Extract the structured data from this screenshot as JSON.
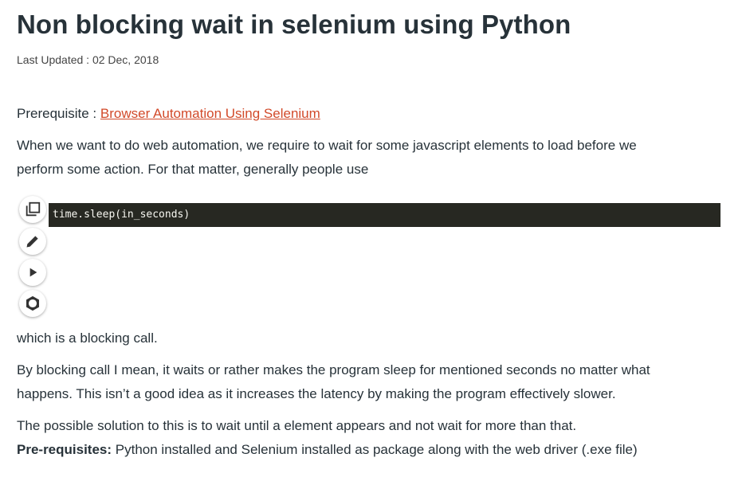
{
  "article": {
    "title": "Non blocking wait in selenium using Python",
    "last_updated": "Last Updated : 02 Dec, 2018",
    "prereq_prefix": "Prerequisite : ",
    "prereq_link": "Browser Automation Using Selenium",
    "para1_line1": "When we want to do web automation, we require to wait for some javascript elements to load before we",
    "para1_line2": "perform some action. For that matter, generally people use",
    "code": "time.sleep(in_seconds)",
    "para2": "which is a blocking call.",
    "para3_line1": "By blocking call I mean, it waits or rather makes the program sleep for mentioned seconds no matter what",
    "para3_line2": "happens. This isn’t a good idea as it increases the latency by making the program effectively slower.",
    "para4": "The possible solution to this is to wait until a element appears and not wait for more than that.",
    "prereqs_label": "Pre-requisites:",
    "prereqs_text": " Python installed and Selenium installed as package along with the web driver (.exe file)"
  },
  "code_toolbar": {
    "icons": [
      "copy-icon",
      "edit-icon",
      "run-icon",
      "settings-icon"
    ]
  },
  "colors": {
    "text": "#273239",
    "link": "#d24a2a",
    "code_bg": "#272822",
    "code_text": "#f8f8f2"
  }
}
